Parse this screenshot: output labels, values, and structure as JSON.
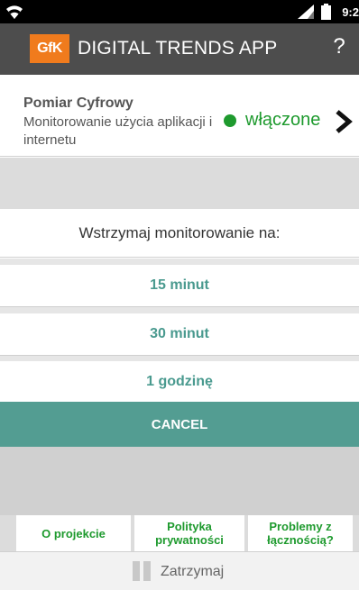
{
  "status_bar": {
    "time": "9:2"
  },
  "app_bar": {
    "logo": "GfK",
    "title": "DIGITAL TRENDS APP",
    "help": "?"
  },
  "measurement": {
    "title": "Pomiar Cyfrowy",
    "description": "Monitorowanie użycia aplikacji i internetu",
    "state": "włączone",
    "state_color": "#1e9a2e"
  },
  "pause_dialog": {
    "prompt": "Wstrzymaj monitorowanie na:",
    "options": [
      "15 minut",
      "30 minut",
      "1 godzinę"
    ],
    "cancel": "CANCEL",
    "accent": "#539d92"
  },
  "tabs": [
    "O projekcie",
    "Polityka prywatności",
    "Problemy z łącznością?"
  ],
  "bottom": {
    "pause_label": "Zatrzymaj"
  }
}
